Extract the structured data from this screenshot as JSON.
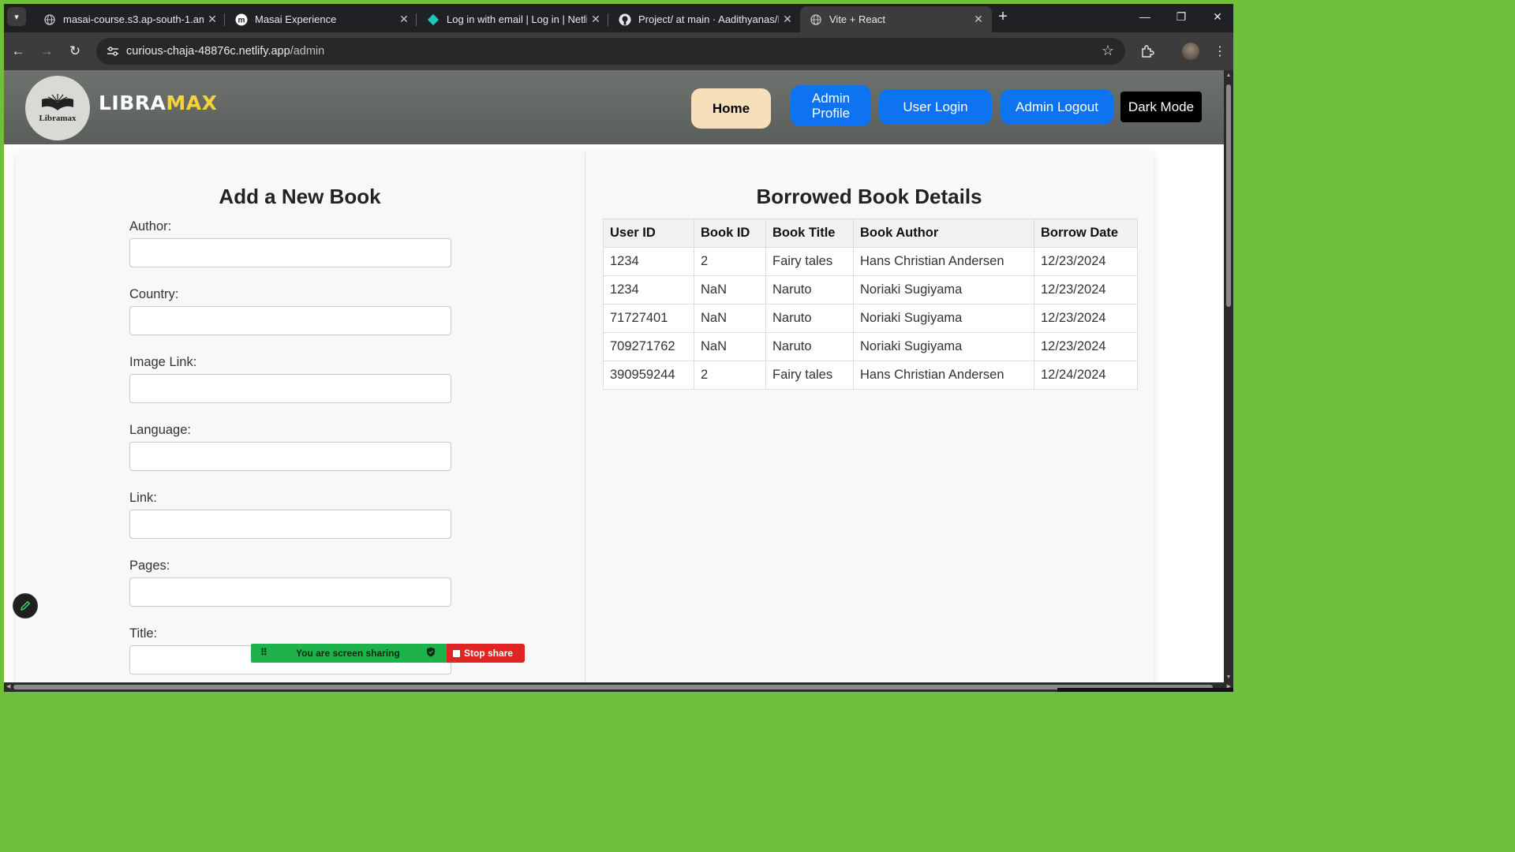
{
  "browser": {
    "tabs": [
      {
        "title": "masai-course.s3.ap-south-1.am",
        "icon": "globe-icon",
        "active": false
      },
      {
        "title": "Masai Experience",
        "icon": "masai-logo-icon",
        "active": false
      },
      {
        "title": "Log in with email | Log in | Netli",
        "icon": "netlify-icon",
        "active": false
      },
      {
        "title": "Project/ at main · Aadithyanas/I",
        "icon": "github-icon",
        "active": false
      },
      {
        "title": "Vite + React",
        "icon": "globe-icon",
        "active": true
      }
    ],
    "url_host": "curious-chaja-48876c.netlify.app",
    "url_path": "/admin"
  },
  "navbar": {
    "logo_text": "Libramax",
    "brand_part1": "LIBRA",
    "brand_part2": "MAX",
    "home_label": "Home",
    "admin_profile_label": "Admin Profile",
    "user_login_label": "User Login",
    "admin_logout_label": "Admin Logout",
    "dark_mode_label": "Dark Mode"
  },
  "add_book": {
    "heading": "Add a New Book",
    "fields": [
      {
        "label": "Author:",
        "value": ""
      },
      {
        "label": "Country:",
        "value": ""
      },
      {
        "label": "Image Link:",
        "value": ""
      },
      {
        "label": "Language:",
        "value": ""
      },
      {
        "label": "Link:",
        "value": ""
      },
      {
        "label": "Pages:",
        "value": ""
      },
      {
        "label": "Title:",
        "value": ""
      }
    ]
  },
  "borrowed": {
    "heading": "Borrowed Book Details",
    "columns": [
      "User ID",
      "Book ID",
      "Book Title",
      "Book Author",
      "Borrow Date"
    ],
    "rows": [
      [
        "1234",
        "2",
        "Fairy tales",
        "Hans Christian Andersen",
        "12/23/2024"
      ],
      [
        "1234",
        "NaN",
        "Naruto",
        "Noriaki Sugiyama",
        "12/23/2024"
      ],
      [
        "71727401",
        "NaN",
        "Naruto",
        "Noriaki Sugiyama",
        "12/23/2024"
      ],
      [
        "709271762",
        "NaN",
        "Naruto",
        "Noriaki Sugiyama",
        "12/23/2024"
      ],
      [
        "390959244",
        "2",
        "Fairy tales",
        "Hans Christian Andersen",
        "12/24/2024"
      ]
    ]
  },
  "screen_share": {
    "message": "You are screen sharing",
    "stop_label": "Stop share"
  },
  "colors": {
    "navbar_bg": "#5f635f",
    "brand_accent": "#f4d23c",
    "home_button": "#f6dfb9",
    "primary_button": "#0d73f0",
    "share_green": "#1db34a",
    "share_red": "#e02424"
  }
}
